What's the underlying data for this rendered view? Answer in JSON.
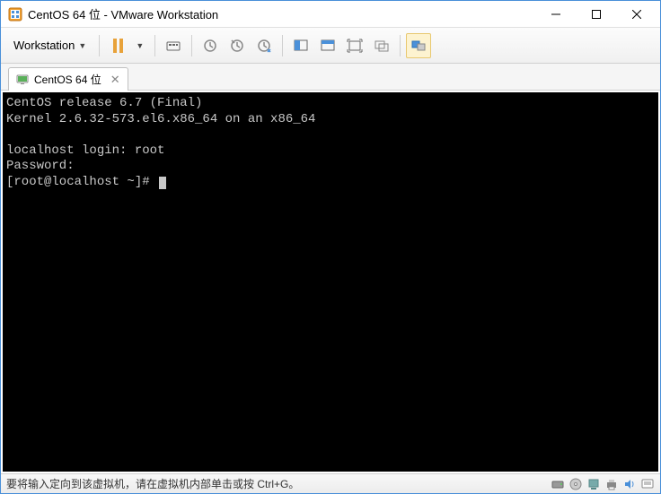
{
  "window": {
    "title": "CentOS 64 位 - VMware Workstation"
  },
  "menu": {
    "workstation": "Workstation"
  },
  "tab": {
    "label": "CentOS 64 位"
  },
  "terminal": {
    "line1": "CentOS release 6.7 (Final)",
    "line2": "Kernel 2.6.32-573.el6.x86_64 on an x86_64",
    "line3": "",
    "line4": "localhost login: root",
    "line5": "Password:",
    "line6": "[root@localhost ~]# "
  },
  "status": {
    "message": "要将输入定向到该虚拟机，请在虚拟机内部单击或按 Ctrl+G。"
  }
}
